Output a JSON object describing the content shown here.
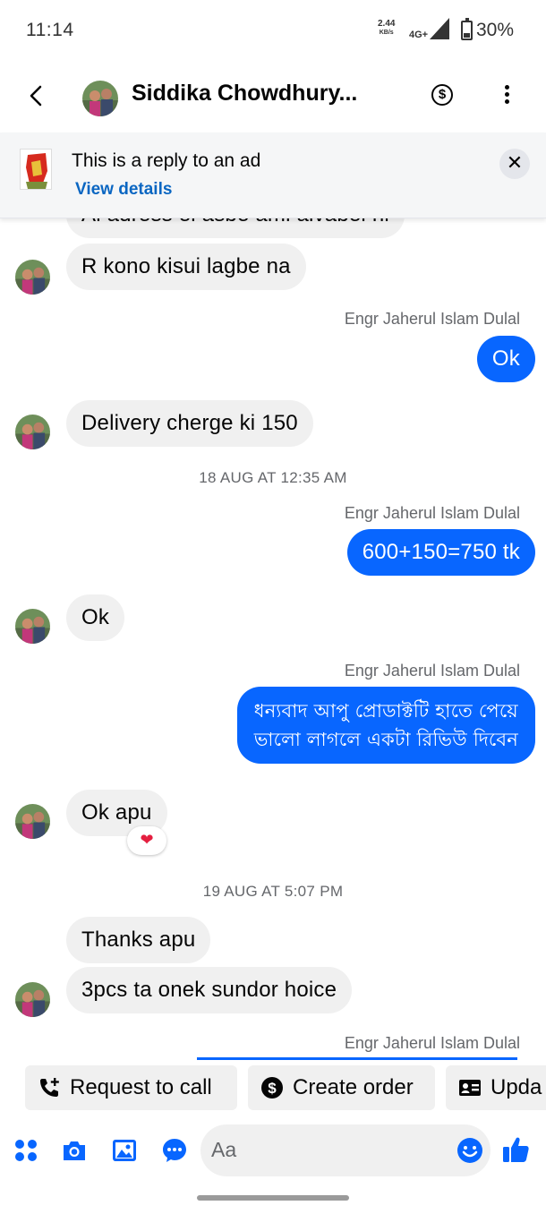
{
  "status_bar": {
    "time": "11:14",
    "net_speed": "2.44",
    "net_speed_unit": "KB/s",
    "network": "4G+",
    "battery": "30%"
  },
  "header": {
    "contact_name": "Siddika Chowdhury..."
  },
  "ad_banner": {
    "title": "This is a reply to an ad",
    "link": "View details",
    "close": "✕"
  },
  "messages": {
    "m0": "Al adress ei asbe ami aivabei ni",
    "m1": "R kono kisui lagbe na",
    "s1": "Engr Jaherul Islam Dulal",
    "m2": "Ok",
    "m3": "Delivery cherge ki 150",
    "t1": "18 AUG AT 12:35 AM",
    "s2": "Engr Jaherul Islam Dulal",
    "m4": "600+150=750 tk",
    "m5": "Ok",
    "s3": "Engr Jaherul Islam Dulal",
    "m6_line1": "ধন্যবাদ আপু প্রোডাক্টটি হাতে পেয়ে",
    "m6_line2": "ভালো লাগলে একটা রিভিউ দিবেন",
    "m7": "Ok apu",
    "m7_reaction": "❤",
    "t2": "19 AUG AT 5:07 PM",
    "m8": "Thanks apu",
    "m9": "3pcs ta onek sundor hoice",
    "s4": "Engr Jaherul Islam Dulal"
  },
  "quick_actions": {
    "request_call": "Request to call",
    "create_order": "Create order",
    "update": "Upda"
  },
  "composer": {
    "placeholder": "Aa"
  },
  "colors": {
    "accent": "#0866ff",
    "incoming_bubble": "#f0f0f0",
    "link": "#0a66c2"
  }
}
